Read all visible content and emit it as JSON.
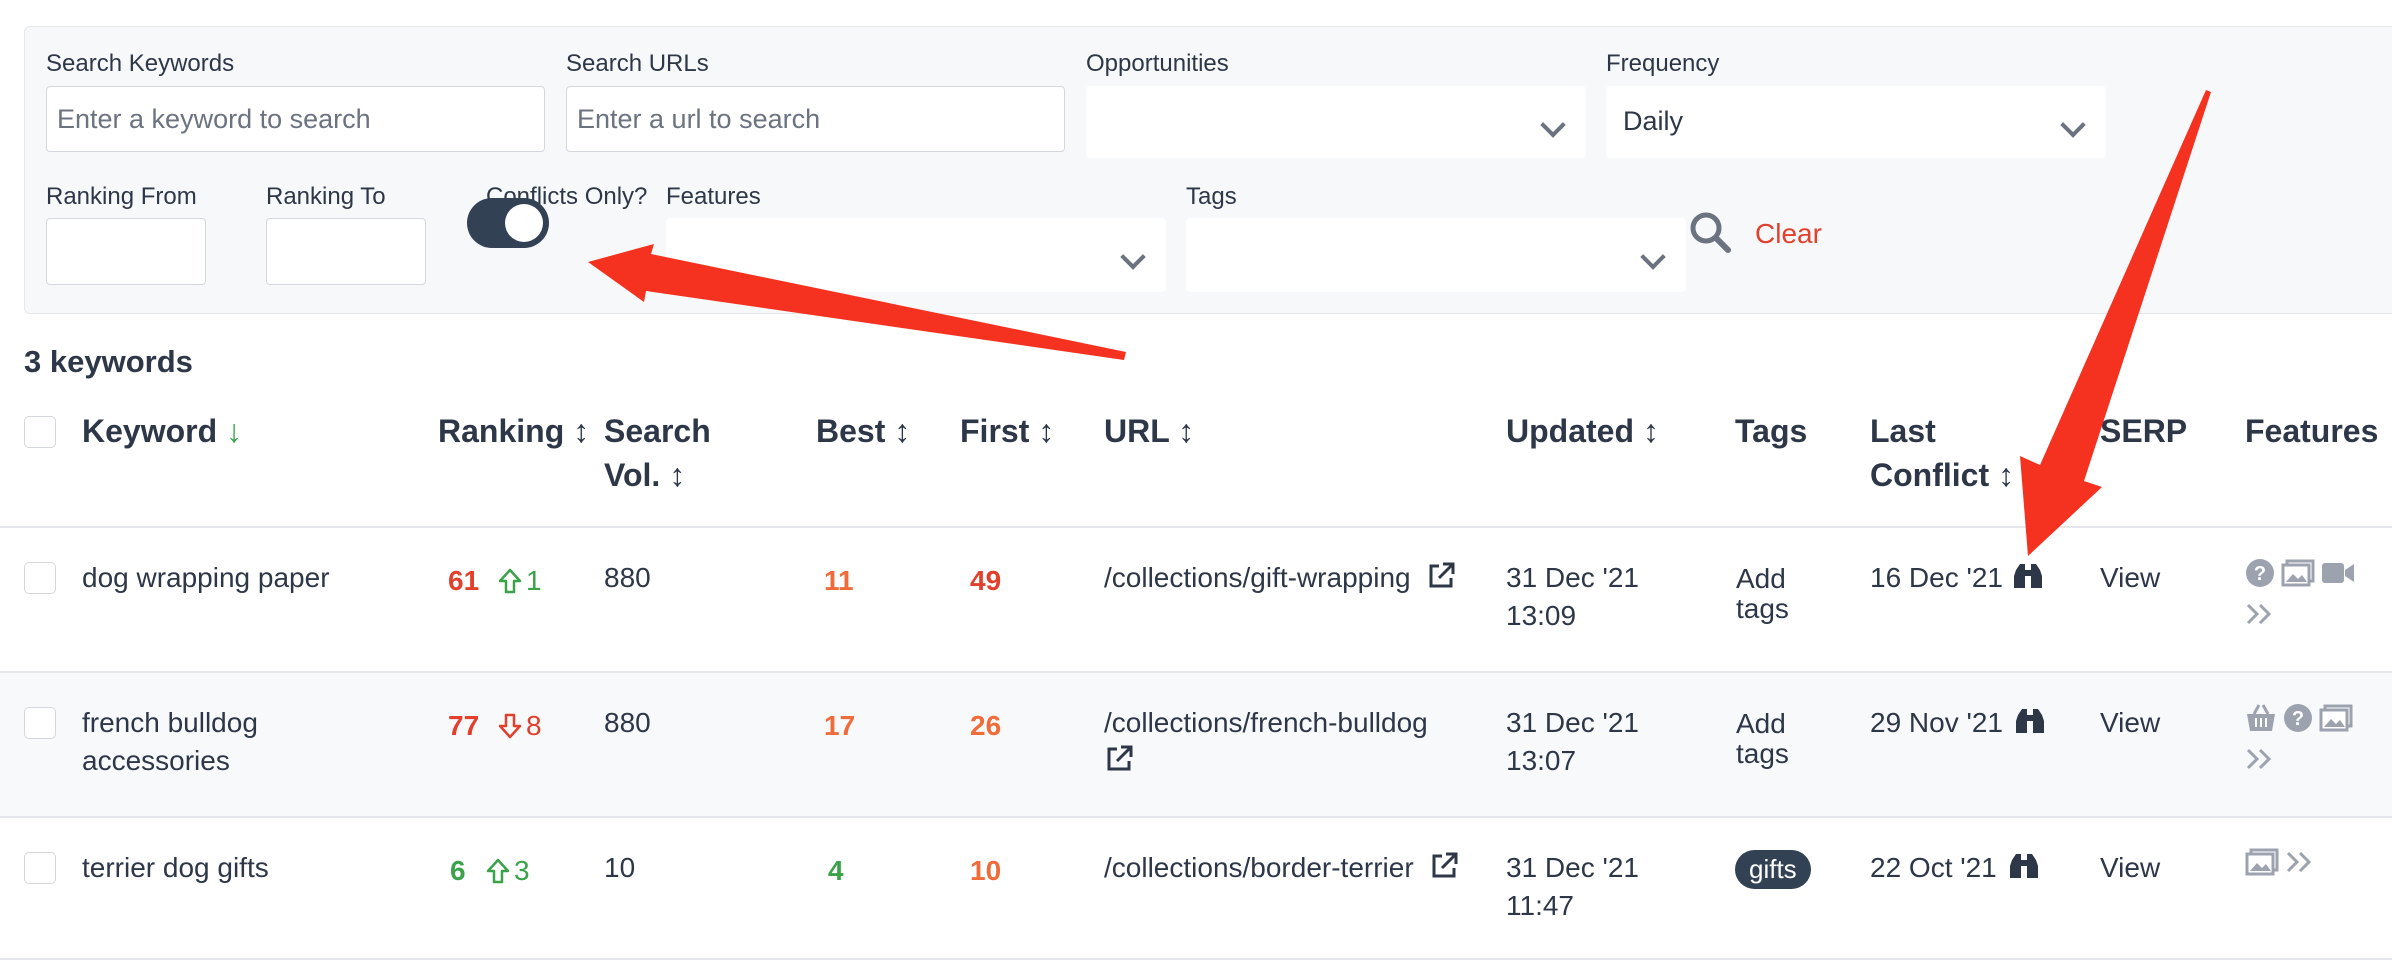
{
  "filters": {
    "search_keywords": {
      "label": "Search Keywords",
      "placeholder": "Enter a keyword to search",
      "value": ""
    },
    "search_urls": {
      "label": "Search URLs",
      "placeholder": "Enter a url to search",
      "value": ""
    },
    "opportunities": {
      "label": "Opportunities",
      "value": ""
    },
    "frequency": {
      "label": "Frequency",
      "value": "Daily"
    },
    "ranking_from": {
      "label": "Ranking From",
      "value": ""
    },
    "ranking_to": {
      "label": "Ranking To",
      "value": ""
    },
    "conflicts_only": {
      "label": "Conflicts Only?",
      "on": true
    },
    "features": {
      "label": "Features",
      "value": ""
    },
    "tags": {
      "label": "Tags",
      "value": ""
    },
    "clear_label": "Clear"
  },
  "count_label": "3 keywords",
  "columns": {
    "keyword": "Keyword",
    "ranking": "Ranking",
    "search_vol_1": "Search",
    "search_vol_2": "Vol.",
    "best": "Best",
    "first": "First",
    "url": "URL",
    "updated": "Updated",
    "tags": "Tags",
    "last_conflict_1": "Last",
    "last_conflict_2": "Conflict",
    "serp": "SERP",
    "features": "Features"
  },
  "rows": [
    {
      "keyword_1": "dog wrapping paper",
      "keyword_2": "",
      "ranking": "61",
      "change": "1",
      "change_dir": "up",
      "search_vol": "880",
      "best": "11",
      "first": "49",
      "url": "/collections/gift-wrapping",
      "updated_date": "31 Dec '21",
      "updated_time": "13:09",
      "tags_1": "Add",
      "tags_2": "tags",
      "last_conflict": "16 Dec '21",
      "serp": "View",
      "features": [
        "question-icon",
        "image-icon",
        "video-icon"
      ]
    },
    {
      "keyword_1": "french bulldog",
      "keyword_2": "accessories",
      "ranking": "77",
      "change": "8",
      "change_dir": "down",
      "search_vol": "880",
      "best": "17",
      "first": "26",
      "url": "/collections/french-bulldog",
      "updated_date": "31 Dec '21",
      "updated_time": "13:07",
      "tags_1": "Add",
      "tags_2": "tags",
      "last_conflict": "29 Nov '21",
      "serp": "View",
      "features": [
        "basket-icon",
        "question-icon",
        "image-icon"
      ]
    },
    {
      "keyword_1": "terrier dog gifts",
      "keyword_2": "",
      "ranking": "6",
      "change": "3",
      "change_dir": "up",
      "search_vol": "10",
      "best": "4",
      "first": "10",
      "url": "/collections/border-terrier",
      "updated_date": "31 Dec '21",
      "updated_time": "11:47",
      "tag_chip": "gifts",
      "last_conflict": "22 Oct '21",
      "serp": "View",
      "features": [
        "image-icon"
      ]
    }
  ],
  "colors": {
    "rank_red": "#e0402c",
    "rank_orange": "#f06b3a",
    "rank_green": "#3aa34a",
    "annotation_arrow": "#f5311f",
    "toggle_on": "#334155"
  }
}
